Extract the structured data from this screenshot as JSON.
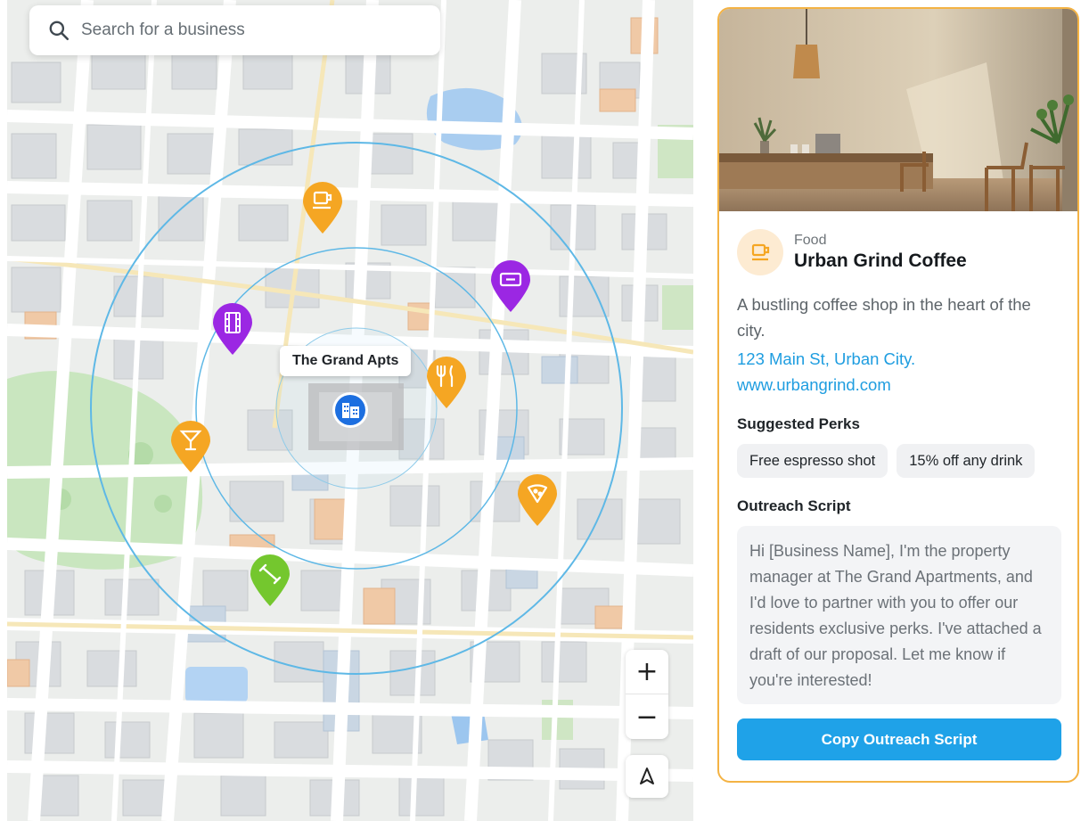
{
  "search": {
    "placeholder": "Search for a business"
  },
  "map": {
    "property_label": "The Grand Apts",
    "pins": [
      {
        "id": "coffee",
        "category": "coffee",
        "color": "#f5a623",
        "icon": "coffee-cup-icon"
      },
      {
        "id": "ticket",
        "category": "entertainment",
        "color": "#9b27e3",
        "icon": "ticket-icon"
      },
      {
        "id": "film",
        "category": "cinema",
        "color": "#9b27e3",
        "icon": "film-icon"
      },
      {
        "id": "restaurant",
        "category": "restaurant",
        "color": "#f5a623",
        "icon": "fork-knife-icon"
      },
      {
        "id": "bar",
        "category": "bar",
        "color": "#f5a623",
        "icon": "cocktail-icon"
      },
      {
        "id": "pizza",
        "category": "pizza",
        "color": "#f5a623",
        "icon": "pizza-slice-icon"
      },
      {
        "id": "fitness",
        "category": "fitness",
        "color": "#74c72e",
        "icon": "dumbbell-icon"
      }
    ],
    "controls": {
      "zoom_in": "+",
      "zoom_out": "−"
    }
  },
  "business": {
    "category": "Food",
    "name": "Urban Grind Coffee",
    "description": "A bustling coffee shop in the heart of the city.",
    "address": "123 Main St, Urban City.",
    "website": "www.urbangrind.com",
    "perks_title": "Suggested Perks",
    "perks": [
      "Free espresso shot",
      "15% off any drink"
    ],
    "script_title": "Outreach Script",
    "script": "Hi [Business Name], I'm the property manager at The Grand Apartments, and I'd love to partner with you to offer our residents exclusive perks. I've attached a draft of our proposal. Let me know if you're interested!",
    "copy_button": "Copy Outreach Script"
  },
  "colors": {
    "accent": "#1fa2e8",
    "card_border": "#f4b344",
    "food": "#f5a623",
    "entertainment": "#9b27e3",
    "fitness": "#74c72e"
  }
}
